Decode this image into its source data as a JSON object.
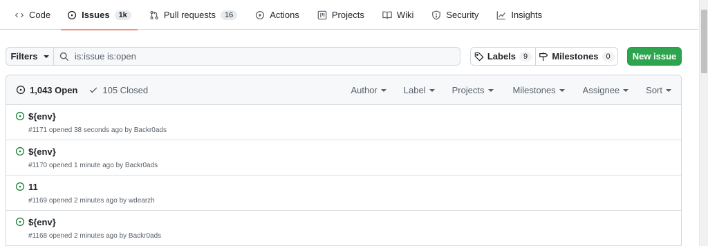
{
  "nav": {
    "tabs": [
      {
        "label": "Code",
        "icon": "code-icon"
      },
      {
        "label": "Issues",
        "icon": "issue-opened-icon",
        "count": "1k"
      },
      {
        "label": "Pull requests",
        "icon": "git-pull-request-icon",
        "count": "16"
      },
      {
        "label": "Actions",
        "icon": "play-icon"
      },
      {
        "label": "Projects",
        "icon": "table-icon"
      },
      {
        "label": "Wiki",
        "icon": "book-icon"
      },
      {
        "label": "Security",
        "icon": "shield-icon"
      },
      {
        "label": "Insights",
        "icon": "graph-icon"
      }
    ]
  },
  "subnav": {
    "filters_label": "Filters",
    "search_value": "is:issue is:open",
    "labels_label": "Labels",
    "labels_count": "9",
    "milestones_label": "Milestones",
    "milestones_count": "0",
    "new_issue_label": "New issue"
  },
  "issues_header": {
    "open_label": "1,043 Open",
    "closed_label": "105 Closed",
    "sorters": [
      "Author",
      "Label",
      "Projects",
      "Milestones",
      "Assignee",
      "Sort"
    ]
  },
  "issues": [
    {
      "title": "${env}",
      "meta": "#1171 opened 38 seconds ago by Backr0ads"
    },
    {
      "title": "${env}",
      "meta": "#1170 opened 1 minute ago by Backr0ads"
    },
    {
      "title": "11",
      "meta": "#1169 opened 2 minutes ago by wdearzh"
    },
    {
      "title": "${env}",
      "meta": "#1168 opened 2 minutes ago by Backr0ads"
    }
  ],
  "colors": {
    "open_green": "#1a7f37",
    "new_issue_bg": "#2da44e",
    "tab_underline": "#fd8c73"
  }
}
